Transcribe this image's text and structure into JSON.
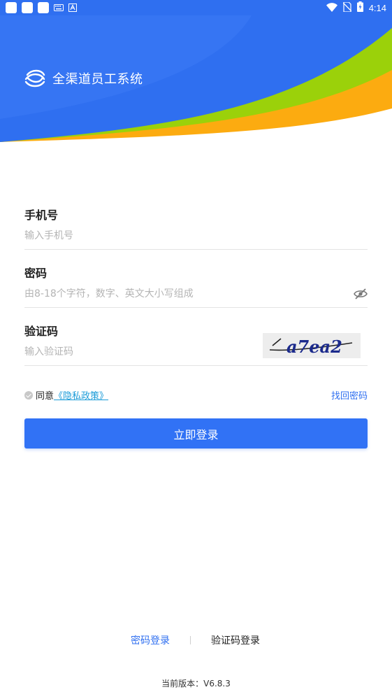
{
  "status_bar": {
    "time": "4:14",
    "left_icons": [
      "app-square-icon",
      "app-square-icon",
      "app-square-icon",
      "keyboard-icon",
      "a-letter-icon"
    ],
    "right_icons": [
      "wifi-icon",
      "no-sim-icon",
      "battery-charging-icon"
    ]
  },
  "header": {
    "logo_icon": "china-mobile-logo-icon",
    "title": "全渠道员工系统",
    "colors": {
      "blue": "#2f6ff0",
      "green": "#9bd10a",
      "orange": "#fcab10"
    }
  },
  "form": {
    "phone": {
      "label": "手机号",
      "placeholder": "输入手机号",
      "value": ""
    },
    "password": {
      "label": "密码",
      "placeholder": "由8-18个字符，数字、英文大小写组成",
      "value": "",
      "toggle_icon": "eye-hidden-icon"
    },
    "captcha": {
      "label": "验证码",
      "placeholder": "输入验证码",
      "value": "",
      "image_text": "a7ea2"
    }
  },
  "agreement": {
    "prefix": "同意",
    "link": "《隐私政策》",
    "forgot": "找回密码"
  },
  "login_button": "立即登录",
  "tabs": {
    "password_login": "密码登录",
    "code_login": "验证码登录"
  },
  "version": "当前版本：V6.8.3",
  "accent_color": "#3172f5"
}
